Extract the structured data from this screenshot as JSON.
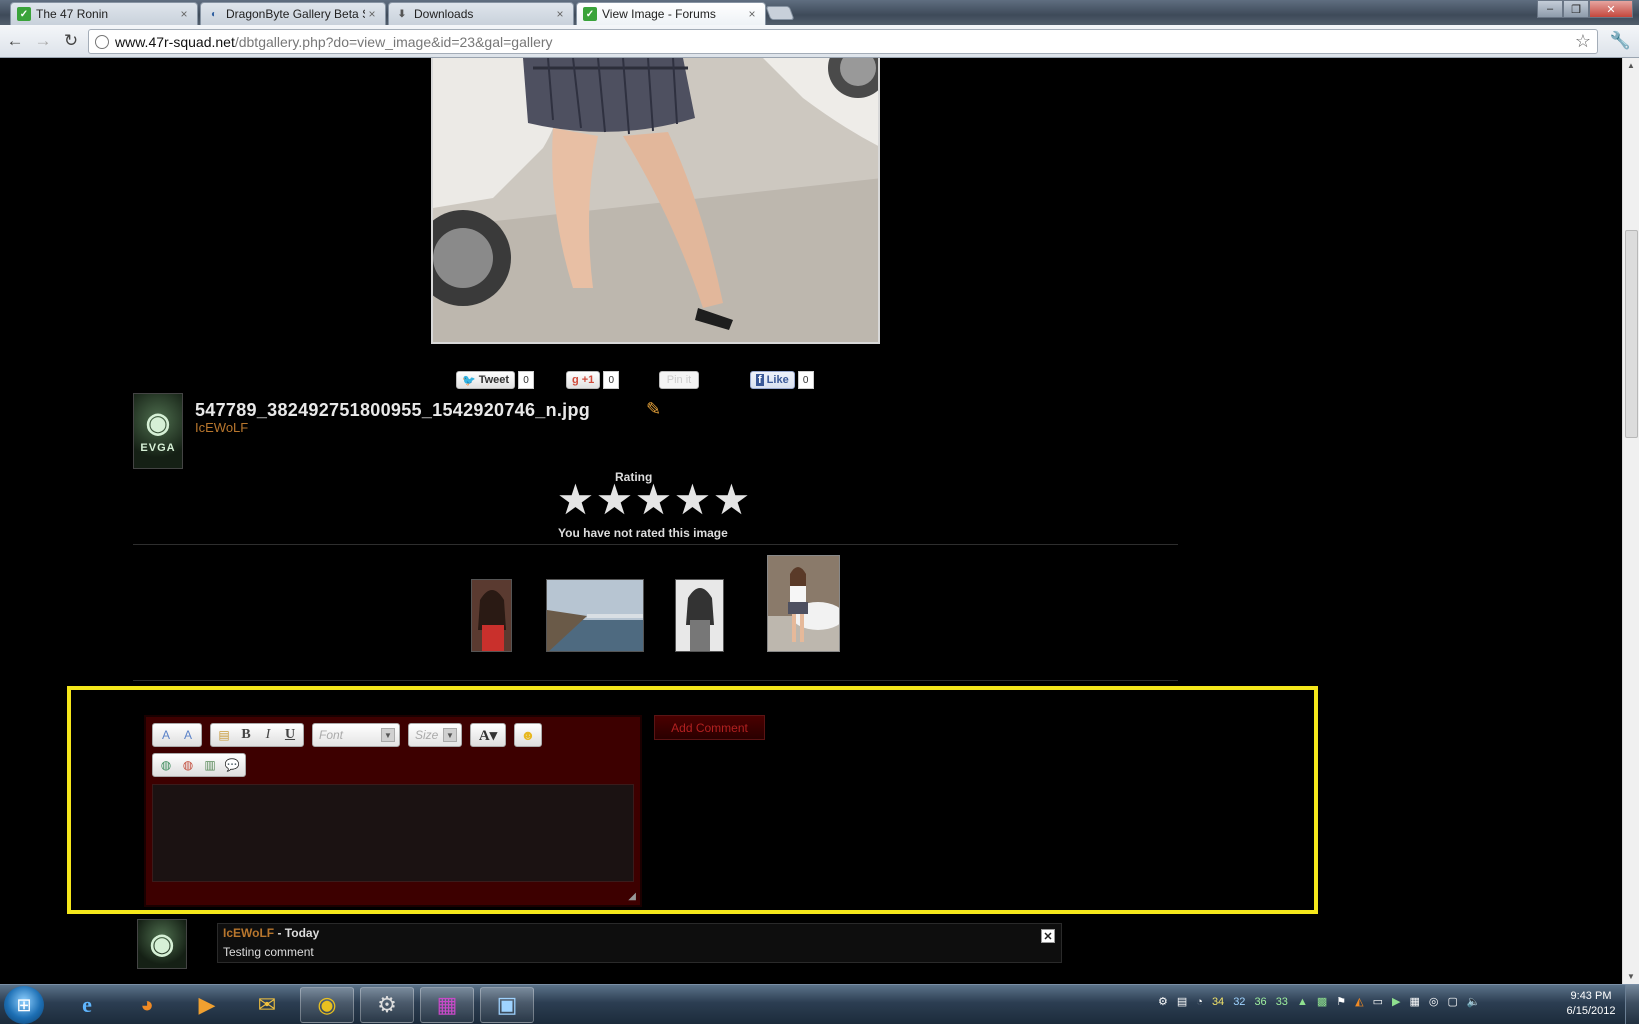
{
  "browser": {
    "tabs": [
      {
        "title": "The 47 Ronin",
        "favicon": "green-forum-icon",
        "active": false
      },
      {
        "title": "DragonByte Gallery Beta Su",
        "favicon": "dragonbyte-icon",
        "active": false
      },
      {
        "title": "Downloads",
        "favicon": "download-icon",
        "active": false
      },
      {
        "title": "View Image - Forums",
        "favicon": "green-forum-icon",
        "active": true
      }
    ],
    "url_host": "www.47r-squad.net",
    "url_path": "/dbtgallery.php?do=view_image&id=23&gal=gallery"
  },
  "share": {
    "tweet_label": "Tweet",
    "tweet_count": "0",
    "plusone_label": "+1",
    "plusone_count": "0",
    "pinit_label": "Pin it",
    "like_label": "Like",
    "like_count": "0"
  },
  "image": {
    "filename": "547789_382492751800955_1542920746_n.jpg",
    "uploader": "IcEWoLF"
  },
  "avatar": {
    "brand": "EVGA"
  },
  "rating": {
    "label": "Rating",
    "max_stars": 5,
    "status": "You have not rated this image"
  },
  "editor": {
    "font_placeholder": "Font",
    "size_placeholder": "Size",
    "add_comment_label": "Add Comment"
  },
  "comments": [
    {
      "author": "IcEWoLF",
      "separator": " - ",
      "when": "Today",
      "text": "Testing comment"
    }
  ],
  "taskbar": {
    "tray_numbers": [
      "34",
      "32",
      "36",
      "33"
    ],
    "time": "9:43 PM",
    "date": "6/15/2012"
  },
  "colors": {
    "page_bg": "#000000",
    "editor_bg": "#3d0000",
    "highlight": "#f5e71b",
    "username": "#b8762d"
  }
}
